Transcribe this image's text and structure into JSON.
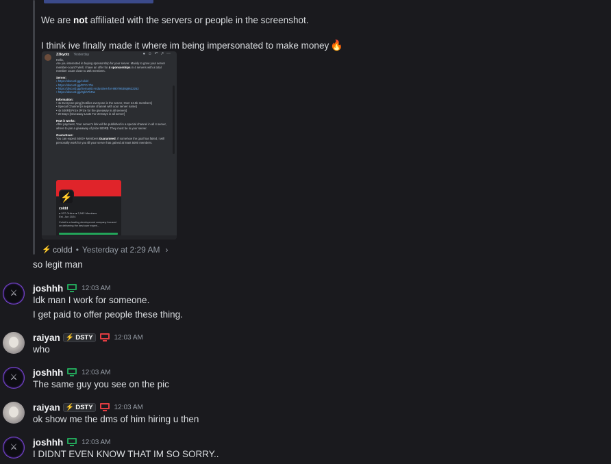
{
  "forwarded": {
    "line1_pre": "We are ",
    "line1_bold": "not",
    "line1_post": " affiliated with the servers or people in the screenshot.",
    "line2": "I think ive finally made it where im being impersonated to make money",
    "emoji": "🔥",
    "screenshot": {
      "name": "Z3kyotz",
      "tag": "Yesterday",
      "greeting": "Hello,",
      "intro_pre": "Are you interested in buying sponsorship for your server. Mainly to grow your server member-count? Well, I have an offer for ",
      "intro_bold": "4 sponsorships",
      "intro_post": " in 4 servers with a total member count close to 25k members.",
      "server_heading": "Server:",
      "server_links": [
        "https://discord.gg/coldd",
        "https://discord.gg/EFCc7hs",
        "https://discord.gg/Semantic-Industries-for-89079638q9622262",
        "https://discord.gg/2gkh7bRw"
      ],
      "info_heading": "Information:",
      "info_items": [
        "4x Everyone ping [Notifies everyone in the server, Over 24.5k members]",
        "Special Channel [A separate channel with your server name]",
        "4x 500R$ Prize [Prize for the giveaway in all servers]",
        "20 Days [Giveaway Lasts For 20 Days in all server]"
      ],
      "how_heading": "How it works:",
      "how_text": "After payment, Your server's link will be published in a special channel in all 4 server, where to join a giveaway of prize 500R$. They must be in your server.",
      "guar_heading": "Guarantees:",
      "guar_pre": "You can expect 5000+ Members ",
      "guar_bold": "Guaranteed",
      "guar_post": ", If somehow the goal has failed, I will personally work for you till your server has gained at least 5000 members.",
      "card": {
        "name": "coldd",
        "stats": "● 537 Online  ● 2,542 Members",
        "est": "Est. Jun 2024",
        "desc": "Coldd is a leading development company focused on delivering the best user experi..."
      }
    },
    "meta": {
      "user": "coldd",
      "time": "Yesterday at 2:29 AM",
      "chevron": "›"
    }
  },
  "messages": [
    {
      "kind": "cont",
      "text": "so legit man"
    },
    {
      "kind": "head",
      "user": "joshhh",
      "time": "12:03 AM",
      "lines": [
        "Idk man I work for someone.",
        "I get paid to offer people these thing."
      ]
    },
    {
      "kind": "head",
      "user": "raiyan",
      "tag": "DSTY",
      "time": "12:03 AM",
      "lines": [
        "who"
      ]
    },
    {
      "kind": "head",
      "user": "joshhh",
      "time": "12:03 AM",
      "lines": [
        "The same guy you see on the pic"
      ]
    },
    {
      "kind": "head",
      "user": "raiyan",
      "tag": "DSTY",
      "time": "12:03 AM",
      "lines": [
        "ok show me the dms of him hiring u then"
      ]
    },
    {
      "kind": "head",
      "user": "joshhh",
      "time": "12:03 AM",
      "lines": [
        "I DIDNT EVEN KNOW THAT IM SO SORRY.."
      ]
    }
  ],
  "colors": {
    "background": "#1a1a1e",
    "online_green": "#23a55a",
    "dnd_red": "#e23d42",
    "link_blue": "#5aa5f0"
  }
}
